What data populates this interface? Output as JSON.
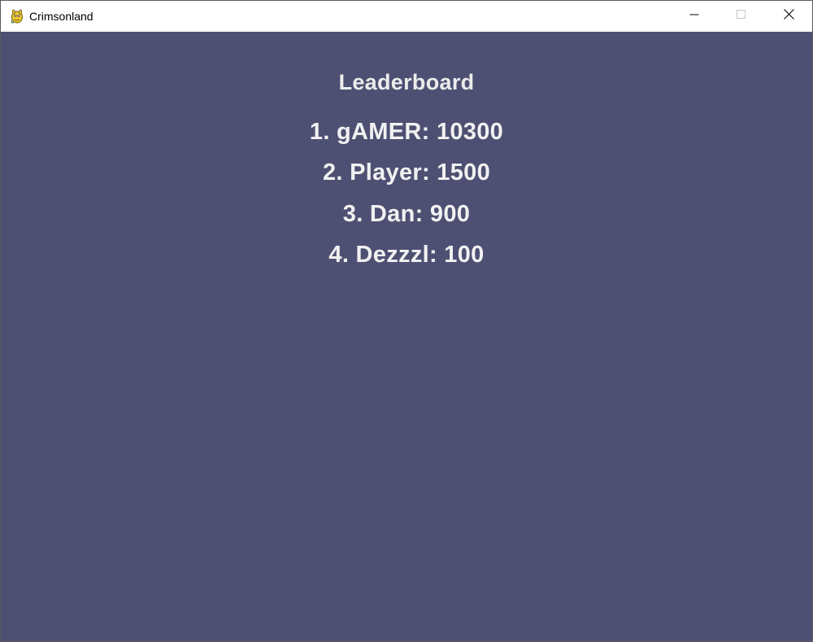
{
  "window": {
    "title": "Crimsonland",
    "icon": "pygame-snake-icon",
    "controls": {
      "minimize_icon": "minimize-icon",
      "maximize_icon": "maximize-icon",
      "close_icon": "close-icon"
    }
  },
  "leaderboard": {
    "title": "Leaderboard",
    "entries": [
      {
        "rank": 1,
        "name": "gAMER",
        "score": 10300,
        "text": "1. gAMER: 10300"
      },
      {
        "rank": 2,
        "name": "Player",
        "score": 1500,
        "text": "2. Player: 1500"
      },
      {
        "rank": 3,
        "name": "Dan",
        "score": 900,
        "text": "3. Dan: 900"
      },
      {
        "rank": 4,
        "name": "Dezzzl",
        "score": 100,
        "text": "4. Dezzzl: 100"
      }
    ]
  },
  "colors": {
    "background": "#4e5073",
    "text": "#f1f1f1",
    "titlebar": "#ffffff"
  }
}
